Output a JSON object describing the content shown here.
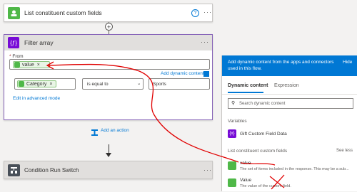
{
  "top_card": {
    "title": "List constituent custom fields",
    "help": "?",
    "more": "···"
  },
  "add_step": "+",
  "filter": {
    "title": "Filter array",
    "more": "···",
    "from_label": "From",
    "from_token": "value",
    "add_dynamic": "Add dynamic content",
    "category_token": "Category",
    "operator": "is equal to",
    "compare_value": "Sports",
    "advanced_link": "Edit in advanced mode",
    "token_close": "×"
  },
  "add_action": "Add an action",
  "bottom_card": {
    "title": "Condition Run Switch",
    "more": "···"
  },
  "panel": {
    "header": "Add dynamic content from the apps and connectors used in this flow.",
    "hide": "Hide",
    "tabs": [
      "Dynamic content",
      "Expression"
    ],
    "search_placeholder": "Search dynamic content",
    "variables_header": "Variables",
    "variable_item": "Gift Custom Field Data",
    "section_header": "List constituent custom fields",
    "see_less": "See less",
    "items": [
      {
        "title": "value",
        "desc": "The set of items included in the response. This may be a sub..."
      },
      {
        "title": "Value",
        "desc": "The value of the custom field."
      }
    ]
  },
  "colors": {
    "accent": "#0078d4",
    "connector_green": "#4fb848",
    "variable_purple": "#770bd6",
    "annotation_red": "#e00000"
  }
}
